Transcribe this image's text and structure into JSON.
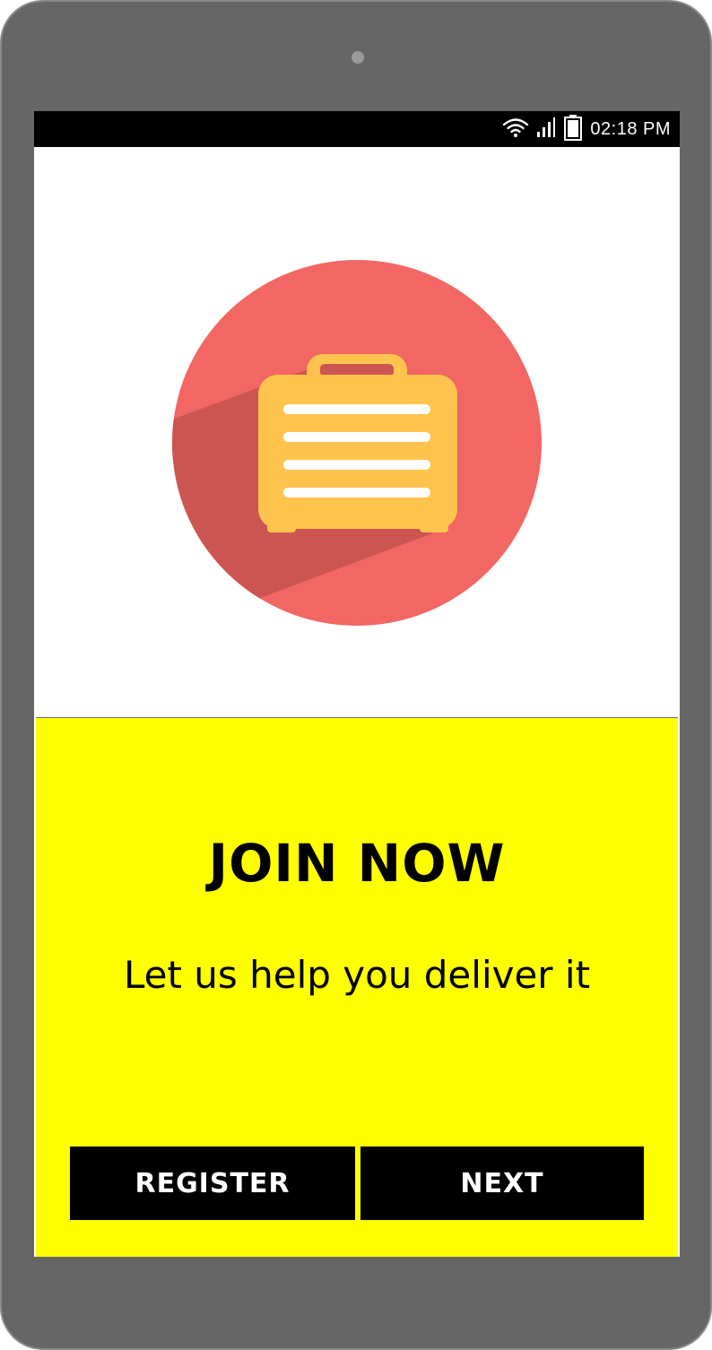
{
  "status_bar": {
    "time": "02:18 PM",
    "icons": [
      "wifi-icon",
      "signal-icon",
      "battery-icon"
    ]
  },
  "hero": {
    "icon": "suitcase-icon",
    "colors": {
      "circle": "#f26663",
      "shadow": "#cc5551",
      "suitcase": "#ffc44e",
      "stripes": "#ffffff"
    }
  },
  "panel": {
    "background": "#ffff00",
    "title": "JOIN NOW",
    "subtitle": "Let us help you deliver it"
  },
  "buttons": {
    "register_label": "REGISTER",
    "next_label": "NEXT"
  }
}
